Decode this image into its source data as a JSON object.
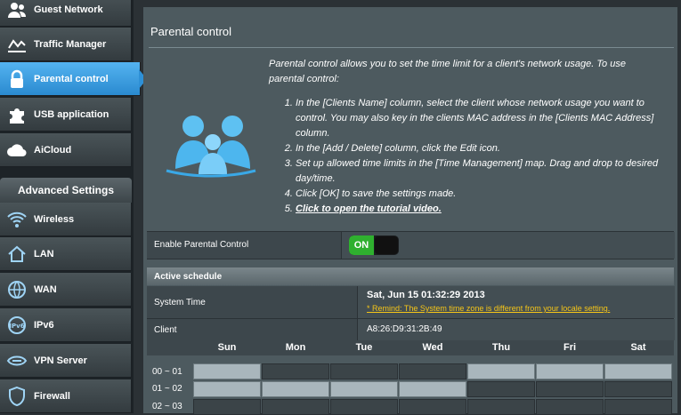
{
  "sidebar": {
    "items": [
      {
        "label": "Guest Network",
        "icon": "guest-network-icon"
      },
      {
        "label": "Traffic Manager",
        "icon": "traffic-manager-icon"
      },
      {
        "label": "Parental control",
        "icon": "lock-icon",
        "active": true
      },
      {
        "label": "USB application",
        "icon": "puzzle-icon"
      },
      {
        "label": "AiCloud",
        "icon": "cloud-icon"
      }
    ],
    "advanced_header": "Advanced Settings",
    "advanced_items": [
      {
        "label": "Wireless",
        "icon": "wireless-icon"
      },
      {
        "label": "LAN",
        "icon": "home-icon"
      },
      {
        "label": "WAN",
        "icon": "globe-icon"
      },
      {
        "label": "IPv6",
        "icon": "ipv6-icon"
      },
      {
        "label": "VPN Server",
        "icon": "vpn-icon"
      },
      {
        "label": "Firewall",
        "icon": "shield-icon"
      }
    ]
  },
  "page": {
    "title": "Parental control",
    "intro": "Parental control allows you to set the time limit for a client's network usage. To use parental control:",
    "steps": [
      "In the [Clients Name] column, select the client whose network usage you want to control. You may also key in the clients MAC address in the [Clients MAC Address] column.",
      "In the [Add / Delete] column, click the Edit icon.",
      "Set up allowed time limits in the [Time Management] map. Drag and drop to desired day/time.",
      "Click [OK] to save the settings made."
    ],
    "tutorial_link": "Click to open the tutorial video."
  },
  "enable": {
    "label": "Enable Parental Control",
    "toggle_text": "ON",
    "enabled": true
  },
  "schedule": {
    "header": "Active schedule",
    "system_time_label": "System Time",
    "system_time": "Sat, Jun 15  01:32:29  2013",
    "remind": "* Remind: The System time zone is different from your locale setting.",
    "client_label": "Client",
    "client_mac": "A8:26:D9:31:2B:49",
    "days": [
      "Sun",
      "Mon",
      "Tue",
      "Wed",
      "Thu",
      "Fri",
      "Sat"
    ],
    "hours": [
      "00 ~ 01",
      "01 ~ 02",
      "02 ~ 03"
    ],
    "selected": [
      [
        1,
        0,
        0,
        0,
        1,
        1,
        1
      ],
      [
        1,
        1,
        1,
        1,
        0,
        0,
        0
      ],
      [
        0,
        0,
        0,
        0,
        0,
        0,
        0
      ]
    ]
  },
  "colors": {
    "accent": "#2e90d6",
    "toggle_on": "#2fb02f",
    "remind": "#f5c518"
  }
}
